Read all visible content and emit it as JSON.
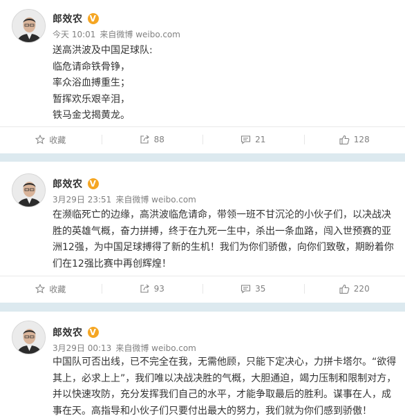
{
  "posts": [
    {
      "author": "郎效农",
      "verified_badge": "V",
      "time": "今天 10:01",
      "source": "来自微博 weibo.com",
      "lines": [
        "送高洪波及中国足球队:",
        "临危请命铁骨铮，",
        "率众浴血搏重生；",
        "暂挥欢乐艰辛泪，",
        "铁马金戈揭黄龙。"
      ],
      "actions": {
        "favorite": "收藏",
        "repost": "88",
        "comment": "21",
        "like": "128"
      }
    },
    {
      "author": "郎效农",
      "verified_badge": "V",
      "time": "3月29日 23:51",
      "source": "来自微博 weibo.com",
      "lines": [
        "在濒临死亡的边缘，高洪波临危请命，带领一班不甘沉沦的小伙子们，以决战决",
        "胜的英雄气概，奋力拼搏，终于在九死一生中，杀出一条血路，闯入世预赛的亚",
        "洲12强，为中国足球搏得了新的生机！我们为你们骄傲，向你们致敬，期盼着你",
        "们在12强比赛中再创辉煌！"
      ],
      "actions": {
        "favorite": "收藏",
        "repost": "93",
        "comment": "35",
        "like": "220"
      }
    },
    {
      "author": "郎效农",
      "verified_badge": "V",
      "time": "3月29日 00:13",
      "source": "来自微博 weibo.com",
      "lines": [
        "中国队可否出线，已不完全在我，无需他顾，只能下定决心，力拼卡塔尔。“欲得",
        "其上，必求上上”，我们唯以决战决胜的气概，大胆通迫，竭力压制和限制对方，",
        "并以快速攻防，充分发挥我们自己的水平，才能争取最后的胜利。谋事在人，成",
        "事在天。高指导和小伙子们只要付出最大的努力，我们就为你们感到骄傲！"
      ]
    }
  ],
  "colors": {
    "page_bg": "#dce9ef",
    "card_bg": "#ffffff",
    "name": "#333333",
    "meta": "#808080",
    "verified": "#f5a623"
  },
  "icons": [
    "avatar",
    "verified-icon",
    "star-icon",
    "repost-icon",
    "comment-icon",
    "like-icon"
  ]
}
